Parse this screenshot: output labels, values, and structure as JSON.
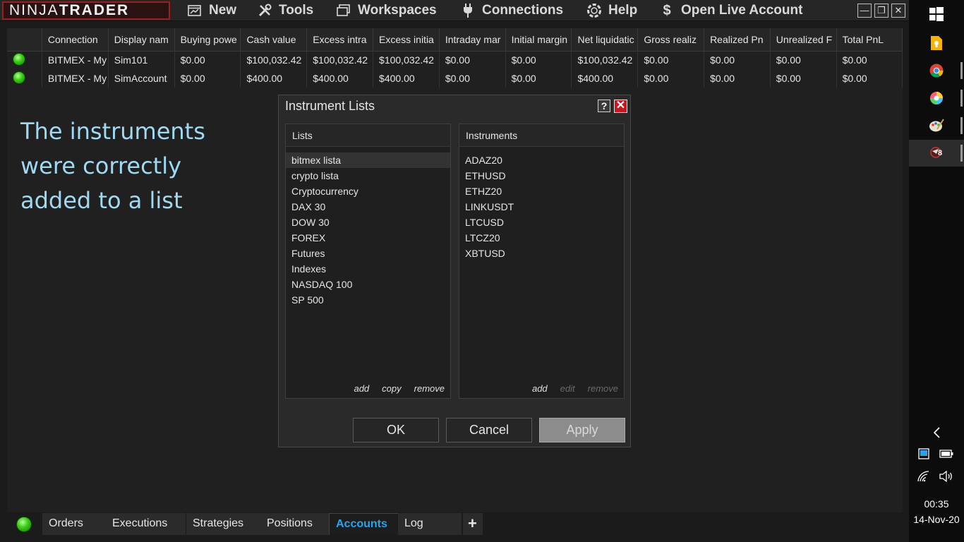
{
  "app": {
    "logo_light": "NINJA",
    "logo_bold": "TRADER"
  },
  "menu": {
    "new": "New",
    "tools": "Tools",
    "workspaces": "Workspaces",
    "connections": "Connections",
    "help": "Help",
    "open_live_account": "Open Live Account"
  },
  "window_controls": {
    "minimize": "—",
    "restore": "❐",
    "close": "✕"
  },
  "accounts_grid": {
    "columns": [
      "Connection",
      "Display nam",
      "Buying powe",
      "Cash value",
      "Excess intra",
      "Excess initia",
      "Intraday mar",
      "Initial margin",
      "Net liquidatic",
      "Gross realiz",
      "Realized Pn",
      "Unrealized F",
      "Total PnL"
    ],
    "rows": [
      [
        "BITMEX - My",
        "Sim101",
        "$0.00",
        "$100,032.42",
        "$100,032.42",
        "$100,032.42",
        "$0.00",
        "$0.00",
        "$100,032.42",
        "$0.00",
        "$0.00",
        "$0.00",
        "$0.00"
      ],
      [
        "BITMEX - My",
        "SimAccount",
        "$0.00",
        "$400.00",
        "$400.00",
        "$400.00",
        "$0.00",
        "$0.00",
        "$400.00",
        "$0.00",
        "$0.00",
        "$0.00",
        "$0.00"
      ]
    ]
  },
  "annotation": {
    "line1": "The instruments",
    "line2": "were correctly",
    "line3": "added to a list"
  },
  "dialog": {
    "title": "Instrument Lists",
    "help": "?",
    "close": "✕",
    "lists_header": "Lists",
    "lists": [
      "bitmex lista",
      "crypto lista",
      "Cryptocurrency",
      "DAX 30",
      "DOW 30",
      "FOREX",
      "Futures",
      "Indexes",
      "NASDAQ 100",
      "SP 500"
    ],
    "lists_actions": {
      "add": "add",
      "copy": "copy",
      "remove": "remove"
    },
    "instruments_header": "Instruments",
    "instruments": [
      "ADAZ20",
      "ETHUSD",
      "ETHZ20",
      "LINKUSDT",
      "LTCUSD",
      "LTCZ20",
      "XBTUSD"
    ],
    "instruments_actions": {
      "add": "add",
      "edit": "edit",
      "remove": "remove"
    },
    "ok": "OK",
    "cancel": "Cancel",
    "apply": "Apply"
  },
  "tabs": {
    "orders": "Orders",
    "executions": "Executions",
    "strategies": "Strategies",
    "positions": "Positions",
    "accounts": "Accounts",
    "log": "Log",
    "add": "+"
  },
  "taskbar": {
    "time": "00:35",
    "date": "14-Nov-20",
    "badge": "8"
  },
  "colors": {
    "accent_blue": "#2ba3ea",
    "annotation": "#9fd9f2",
    "close_red": "#c8171f",
    "connected_green": "#3ed01a"
  }
}
